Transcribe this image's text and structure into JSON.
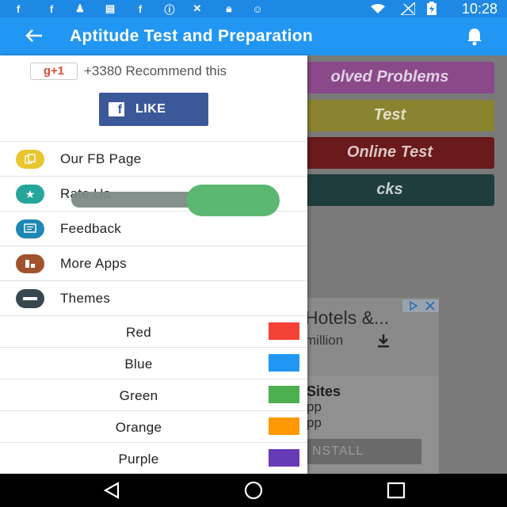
{
  "status_bar": {
    "time": "10:28",
    "icons": [
      "facebook-icon",
      "facebook-icon",
      "chess-icon",
      "message-icon",
      "facebook-icon",
      "info-icon",
      "tools-icon",
      "lock-icon",
      "android-icon",
      "wifi-icon",
      "no-signal-icon",
      "battery-charging-icon"
    ]
  },
  "app_bar": {
    "title": "Aptitude Test and Preparation",
    "back_icon": "arrow-left-icon",
    "notification_icon": "bell-icon",
    "color": "#2196f3"
  },
  "background_menu": [
    {
      "label": "olved Problems",
      "color": "#8a4a8a"
    },
    {
      "label": "Test",
      "color": "#8a8330"
    },
    {
      "label": "Online Test",
      "color": "#6a1a1a"
    },
    {
      "label": "cks",
      "color": "#1f3d3d"
    }
  ],
  "ad": {
    "headline": "Hotels &...",
    "subline": "million",
    "panel_title": "Sites",
    "panel_line1": "pp",
    "panel_line2": "pp",
    "install_label": "NSTALL"
  },
  "drawer": {
    "gplus_label": "g+1",
    "gplus_count": "+3380 Recommend this",
    "fb_like_label": "LIKE",
    "items": [
      {
        "label": "Our FB Page",
        "icon": "pages-icon",
        "color": "#e8c62e"
      },
      {
        "label": "Rate Us",
        "icon": "star-icon",
        "color": "#26a69a"
      },
      {
        "label": "Feedback",
        "icon": "feedback-icon",
        "color": "#1e88b5"
      },
      {
        "label": "More Apps",
        "icon": "apps-icon",
        "color": "#a0522d"
      },
      {
        "label": "Themes",
        "icon": "themes-icon",
        "color": "#37474f"
      }
    ],
    "themes": [
      {
        "label": "Red",
        "color": "#f44336"
      },
      {
        "label": "Blue",
        "color": "#2196f3"
      },
      {
        "label": "Green",
        "color": "#4caf50"
      },
      {
        "label": "Orange",
        "color": "#ff9800"
      },
      {
        "label": "Purple",
        "color": "#673ab7"
      }
    ]
  },
  "nav_bar": {
    "back": "nav-back-icon",
    "home": "nav-home-icon",
    "recents": "nav-recents-icon"
  }
}
